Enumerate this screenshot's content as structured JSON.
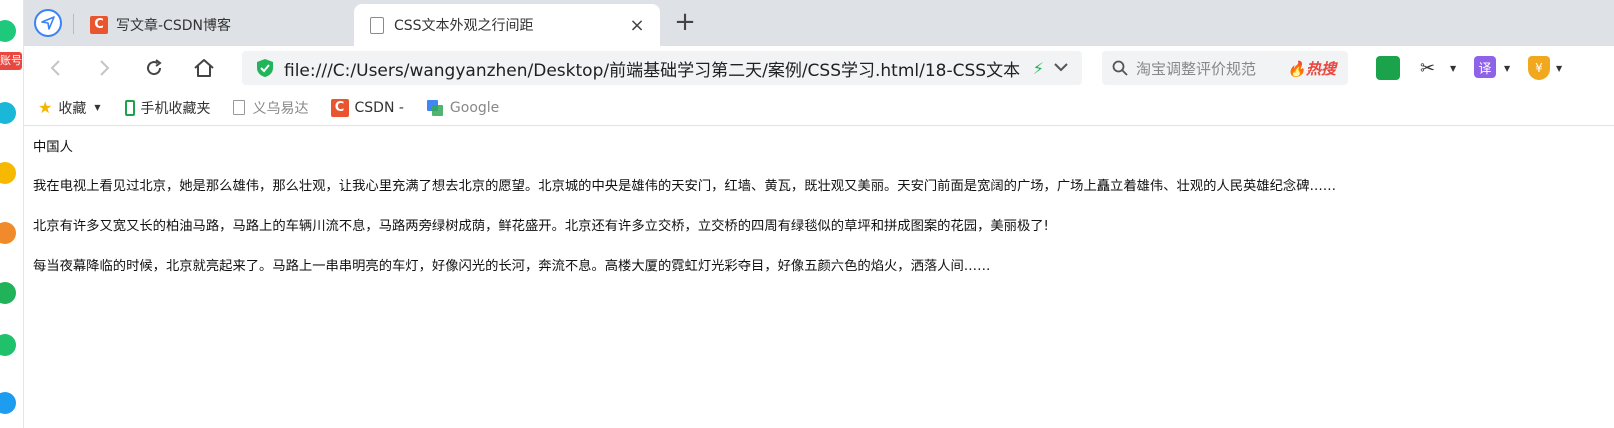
{
  "side": {
    "badge": "账号"
  },
  "tabs": [
    {
      "label": "写文章-CSDN博客",
      "favicon": "C"
    },
    {
      "label": "CSS文本外观之行间距",
      "close": "×"
    }
  ],
  "new_tab": "+",
  "toolbar": {
    "url": "file:///C:/Users/wangyanzhen/Desktop/前端基础学习第二天/案例/CSS学习.html/18-CSS文本",
    "search_placeholder": "淘宝调整评价规范",
    "hot_label": "热搜",
    "translate_label": "译",
    "shield_label": "¥"
  },
  "bookmarks": {
    "favorites": "收藏",
    "mobile": "手机收藏夹",
    "yiwu": "义乌易达",
    "csdn": "CSDN -",
    "google": "Google"
  },
  "page": {
    "paragraphs": [
      "中国人",
      "我在电视上看见过北京，她是那么雄伟，那么壮观，让我心里充满了想去北京的愿望。北京城的中央是雄伟的天安门，红墙、黄瓦，既壮观又美丽。天安门前面是宽阔的广场，广场上矗立着雄伟、壮观的人民英雄纪念碑……",
      "北京有许多又宽又长的柏油马路，马路上的车辆川流不息，马路两旁绿树成荫，鲜花盛开。北京还有许多立交桥，立交桥的四周有绿毯似的草坪和拼成图案的花园，美丽极了!",
      "每当夜幕降临的时候，北京就亮起来了。马路上一串串明亮的车灯，好像闪光的长河，奔流不息。高楼大厦的霓虹灯光彩夺目，好像五颜六色的焰火，洒落人间……"
    ]
  },
  "colors": {
    "accent": "#3b82f6",
    "csdn": "#e9552f",
    "hot": "#e9473f",
    "green": "#1aa34a"
  }
}
